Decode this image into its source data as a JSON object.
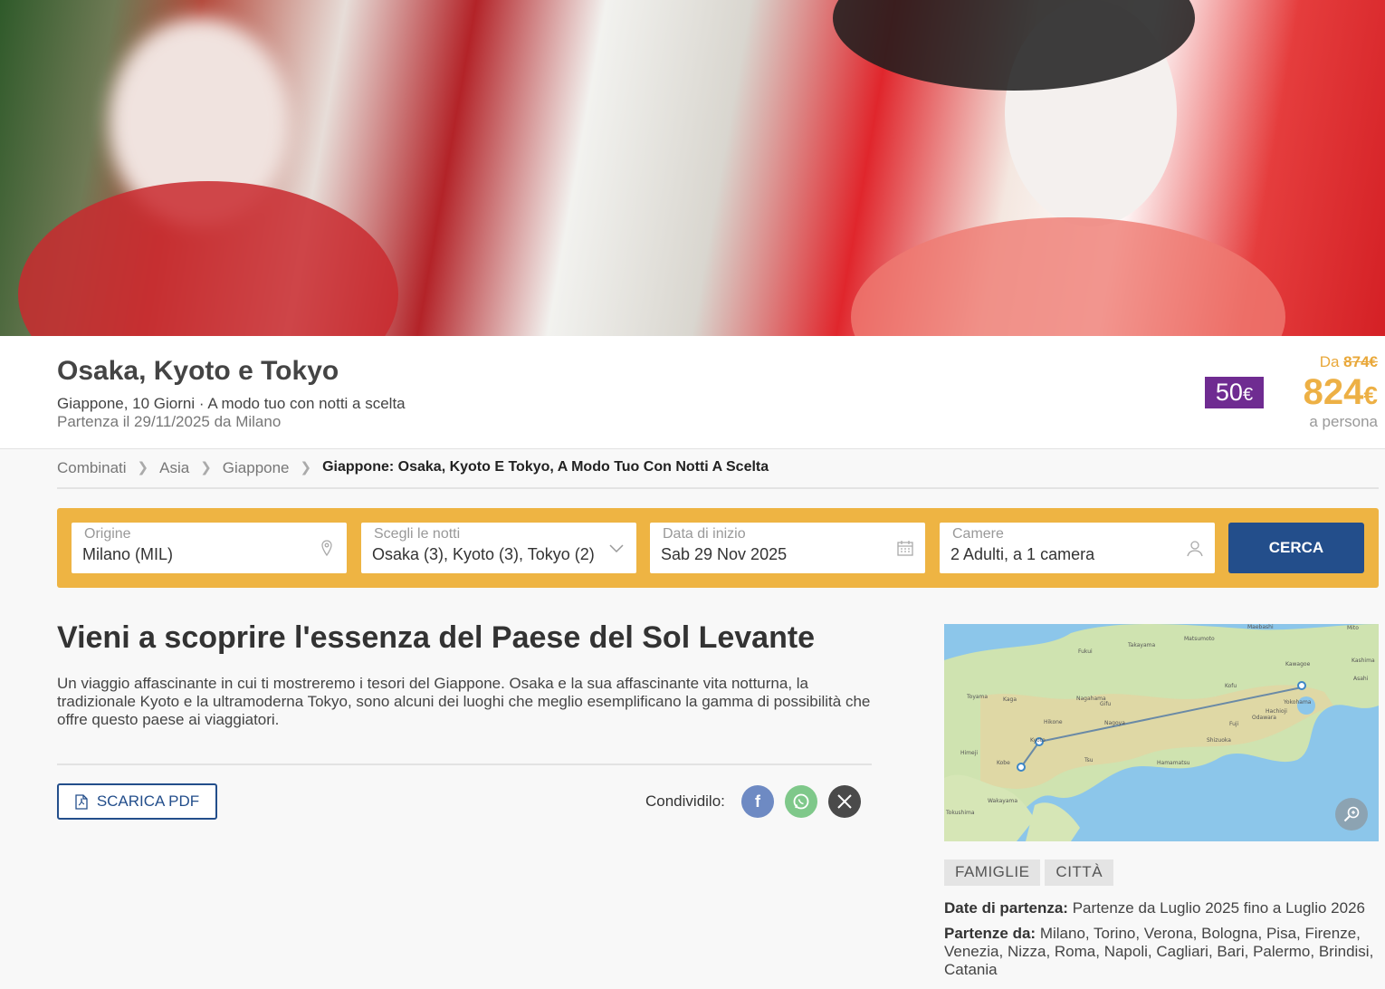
{
  "hero": {
    "alt": "Geishas with red umbrellas"
  },
  "header": {
    "title": "Osaka, Kyoto e Tokyo",
    "subtitle": "Giappone, 10 Giorni · A modo tuo con notti a scelta",
    "departure": "Partenza il 29/11/2025 da Milano",
    "discount_value": "50",
    "currency": "€",
    "price_from_label": "Da",
    "old_price": "874€",
    "price": "824",
    "per_person": "a persona"
  },
  "breadcrumb": {
    "items": [
      "Combinati",
      "Asia",
      "Giappone"
    ],
    "current": "Giappone: Osaka, Kyoto E Tokyo, A Modo Tuo Con Notti A Scelta"
  },
  "search": {
    "origin": {
      "label": "Origine",
      "value": "Milano (MIL)"
    },
    "nights": {
      "label": "Scegli le notti",
      "value": "Osaka (3), Kyoto (3), Tokyo (2)"
    },
    "start_date": {
      "label": "Data di inizio",
      "value": "Sab 29 Nov 2025"
    },
    "rooms": {
      "label": "Camere",
      "value": "2 Adulti, a 1 camera"
    },
    "button": "CERCA"
  },
  "main": {
    "heading": "Vieni a scoprire l'essenza del Paese del Sol Levante",
    "description": "Un viaggio affascinante in cui ti mostreremo i tesori del Giappone. Osaka e la sua affascinante vita notturna, la tradizionale Kyoto e la ultramoderna Tokyo, sono alcuni dei luoghi che meglio esemplificano la gamma di possibilità che offre questo paese ai viaggiatori.",
    "pdf_button": "SCARICA PDF",
    "share_label": "Condividilo:"
  },
  "social": [
    {
      "name": "facebook-icon",
      "glyph": "f",
      "color": "#6e8ac3"
    },
    {
      "name": "whatsapp-icon",
      "glyph": "✆",
      "color": "#7fc88a"
    },
    {
      "name": "x-icon",
      "glyph": "𝕏",
      "color": "#4a4a4a"
    }
  ],
  "map": {
    "labels": [
      "Toyama",
      "Fukui",
      "Takayama",
      "Matsumoto",
      "Maebashi",
      "Mito",
      "Kaga",
      "Nagahama",
      "Kofu",
      "Kawagoe",
      "Kashima",
      "Hikone",
      "Gifu",
      "Hachioji",
      "Kyoto",
      "Nagoya",
      "Yokohama",
      "Asahi",
      "Himeji",
      "Kobe",
      "Tsu",
      "Shizuoka",
      "Odawara",
      "Fuji",
      "Hamamatsu",
      "Wakayama",
      "Tokushima"
    ]
  },
  "tags": [
    "FAMIGLIE",
    "CITTÀ"
  ],
  "details": {
    "dates_label": "Date di partenza:",
    "dates_value": "Partenze da Luglio 2025 fino a Luglio 2026",
    "from_label": "Partenze da:",
    "from_value": "Milano, Torino, Verona, Bologna, Pisa, Firenze, Venezia, Nizza, Roma, Napoli, Cagliari, Bari, Palermo, Brindisi, Catania"
  },
  "colors": {
    "accent_yellow": "#eeb443",
    "primary_blue": "#234e8b",
    "discount_purple": "#6f2c91",
    "price_orange": "#edb045"
  }
}
